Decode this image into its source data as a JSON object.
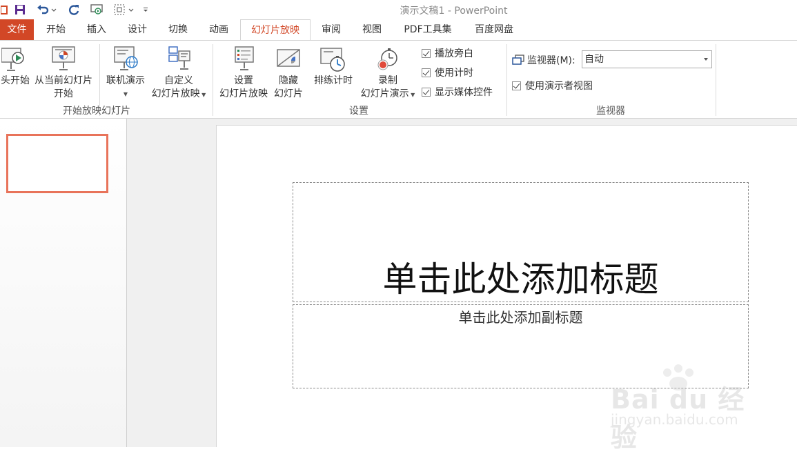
{
  "window": {
    "title": "演示文稿1 - PowerPoint"
  },
  "tabs": [
    {
      "label": "文件"
    },
    {
      "label": "开始"
    },
    {
      "label": "插入"
    },
    {
      "label": "设计"
    },
    {
      "label": "切换"
    },
    {
      "label": "动画"
    },
    {
      "label": "幻灯片放映"
    },
    {
      "label": "审阅"
    },
    {
      "label": "视图"
    },
    {
      "label": "PDF工具集"
    },
    {
      "label": "百度网盘"
    }
  ],
  "active_tab": "幻灯片放映",
  "ribbon": {
    "start_group": {
      "label": "开始放映幻灯片",
      "from_beginning": "头开始",
      "from_current_l1": "从当前幻灯片",
      "from_current_l2": "开始",
      "online_l1": "联机演示",
      "custom_l1": "自定义",
      "custom_l2": "幻灯片放映"
    },
    "setup_group": {
      "label": "设置",
      "setup_l1": "设置",
      "setup_l2": "幻灯片放映",
      "hide_l1": "隐藏",
      "hide_l2": "幻灯片",
      "rehearse": "排练计时",
      "record_l1": "录制",
      "record_l2": "幻灯片演示",
      "play_narration": "播放旁白",
      "use_timings": "使用计时",
      "show_media": "显示媒体控件"
    },
    "monitor_group": {
      "label": "监视器",
      "monitor_label": "监视器(M):",
      "monitor_value": "自动",
      "presenter_view": "使用演示者视图"
    }
  },
  "slide": {
    "title_placeholder": "单击此处添加标题",
    "subtitle_placeholder": "单击此处添加副标题"
  },
  "watermark": {
    "text": "Bai du 经验",
    "url": "jingyan.baidu.com"
  },
  "colors": {
    "accent": "#d24726",
    "thumb_border": "#e8735a"
  }
}
